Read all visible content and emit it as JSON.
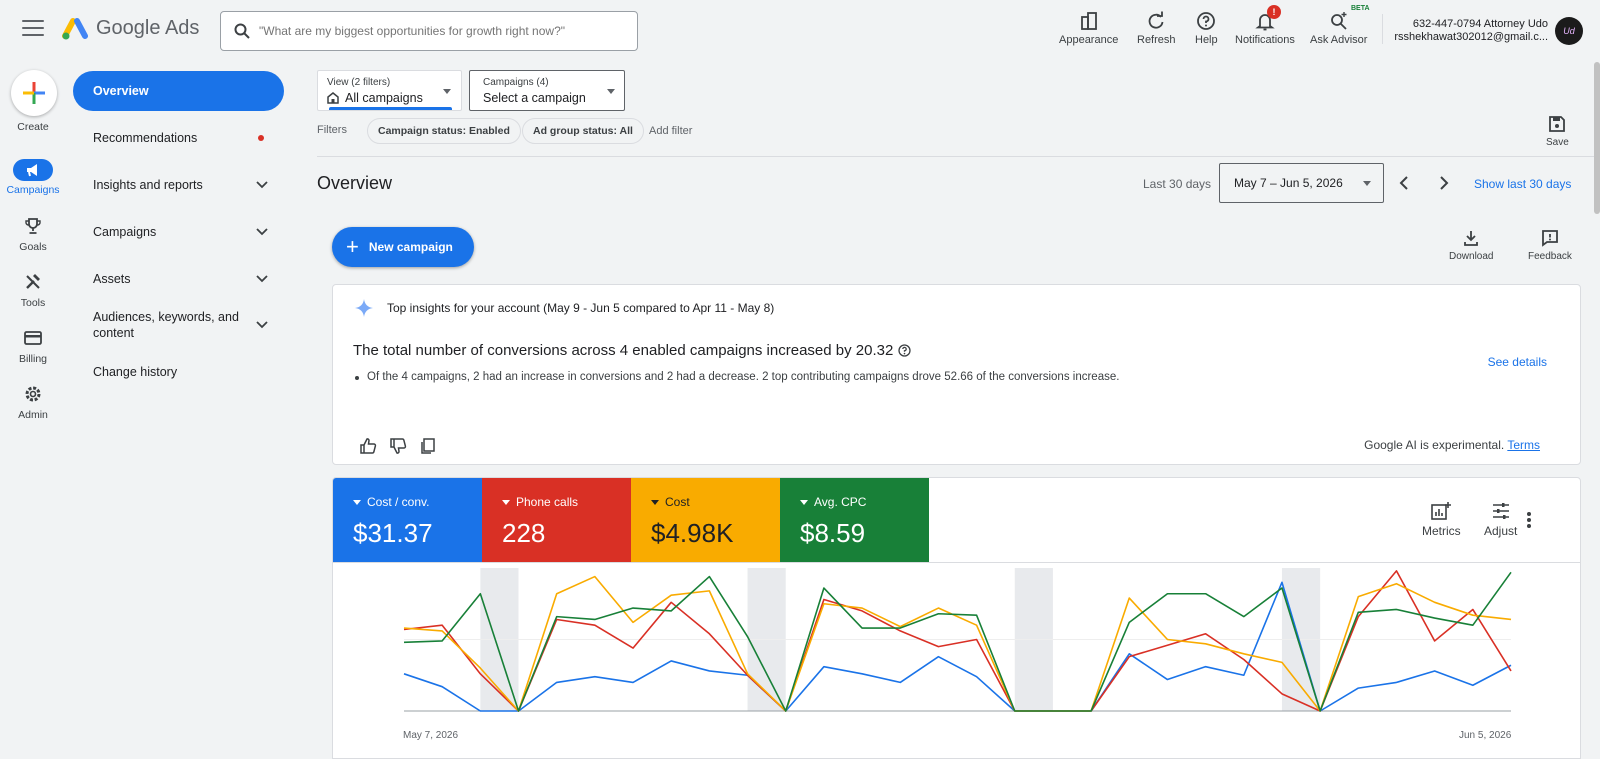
{
  "app": {
    "brand": "Google Ads",
    "search_placeholder": "\"What are my biggest opportunities for growth right now?\""
  },
  "top_actions": [
    {
      "label": "Appearance",
      "icon": "appearance-icon"
    },
    {
      "label": "Refresh",
      "icon": "refresh-icon"
    },
    {
      "label": "Help",
      "icon": "help-icon"
    },
    {
      "label": "Notifications",
      "icon": "bell-icon",
      "badge": "!"
    },
    {
      "label": "Ask Advisor",
      "icon": "advisor-icon",
      "tag": "BETA"
    }
  ],
  "account": {
    "line1": "632-447-0794 Attorney Udo",
    "line2": "rsshekhawat302012@gmail.c...",
    "avatar_text": "Ud"
  },
  "rail": {
    "create": "Create",
    "items": [
      {
        "label": "Campaigns",
        "icon": "megaphone-icon",
        "active": true
      },
      {
        "label": "Goals",
        "icon": "trophy-icon"
      },
      {
        "label": "Tools",
        "icon": "tools-icon"
      },
      {
        "label": "Billing",
        "icon": "credit-card-icon"
      },
      {
        "label": "Admin",
        "icon": "gear-icon"
      }
    ]
  },
  "nav": {
    "overview": "Overview",
    "recommendations": "Recommendations",
    "insights": "Insights and reports",
    "campaigns": "Campaigns",
    "assets": "Assets",
    "audiences_line1": "Audiences, keywords, and",
    "audiences_line2": "content",
    "change_history": "Change history"
  },
  "filterbar": {
    "view_small": "View (2 filters)",
    "view_main": "All campaigns",
    "camp_small": "Campaigns (4)",
    "camp_main": "Select a campaign",
    "filters_label": "Filters",
    "chip1": "Campaign status: Enabled",
    "chip2": "Ad group status: All",
    "add_filter": "Add filter",
    "save": "Save"
  },
  "overview": {
    "title": "Overview",
    "last_label": "Last 30 days",
    "date_range": "May 7 – Jun 5, 2026",
    "show_last": "Show last 30 days",
    "new_campaign": "New campaign",
    "download": "Download",
    "feedback": "Feedback"
  },
  "insight": {
    "header": "Top insights for your account (May 9 - Jun 5 compared to Apr 11 - May 8)",
    "title": "The total number of conversions across 4 enabled campaigns increased by 20.32",
    "bullet": "Of the 4 campaigns, 2 had an increase in conversions and 2 had a decrease. 2 top contributing campaigns drove 52.66 of the conversions increase.",
    "see_details": "See details",
    "ai_note": "Google AI is experimental.",
    "terms": "Terms"
  },
  "metrics": {
    "tiles": [
      {
        "label": "Cost / conv.",
        "value": "$31.37",
        "color": "#1a73e8"
      },
      {
        "label": "Phone calls",
        "value": "228",
        "color": "#d93025"
      },
      {
        "label": "Cost",
        "value": "$4.98K",
        "color": "#f9ab00"
      },
      {
        "label": "Avg. CPC",
        "value": "$8.59",
        "color": "#188038"
      }
    ],
    "metrics_btn": "Metrics",
    "adjust_btn": "Adjust"
  },
  "chart_data": {
    "type": "line",
    "x_start_label": "May 7, 2026",
    "x_end_label": "Jun 5, 2026",
    "ylim": [
      0,
      100
    ],
    "shaded_spans": [
      [
        2,
        3
      ],
      [
        9,
        10
      ],
      [
        16,
        17
      ],
      [
        23,
        24
      ]
    ],
    "series": [
      {
        "color": "#1a73e8",
        "values": [
          26,
          17,
          0,
          0,
          20,
          24,
          20,
          35,
          28,
          25,
          0,
          31,
          26,
          20,
          38,
          24,
          0,
          0,
          0,
          40,
          22,
          31,
          25,
          90,
          0,
          16,
          20,
          28,
          18,
          32
        ]
      },
      {
        "color": "#d93025",
        "values": [
          57,
          60,
          26,
          0,
          64,
          60,
          44,
          76,
          54,
          25,
          0,
          78,
          70,
          56,
          45,
          50,
          0,
          0,
          0,
          38,
          46,
          54,
          36,
          12,
          0,
          66,
          98,
          49,
          71,
          28
        ]
      },
      {
        "color": "#f9ab00",
        "values": [
          58,
          56,
          30,
          0,
          82,
          94,
          62,
          81,
          84,
          26,
          0,
          75,
          72,
          59,
          72,
          60,
          0,
          0,
          0,
          79,
          50,
          47,
          40,
          34,
          0,
          80,
          89,
          76,
          67,
          64
        ]
      },
      {
        "color": "#188038",
        "values": [
          48,
          49,
          82,
          0,
          66,
          64,
          72,
          70,
          94,
          52,
          0,
          86,
          58,
          58,
          68,
          67,
          0,
          0,
          0,
          62,
          82,
          82,
          66,
          86,
          0,
          69,
          71,
          65,
          60,
          97
        ]
      }
    ]
  }
}
